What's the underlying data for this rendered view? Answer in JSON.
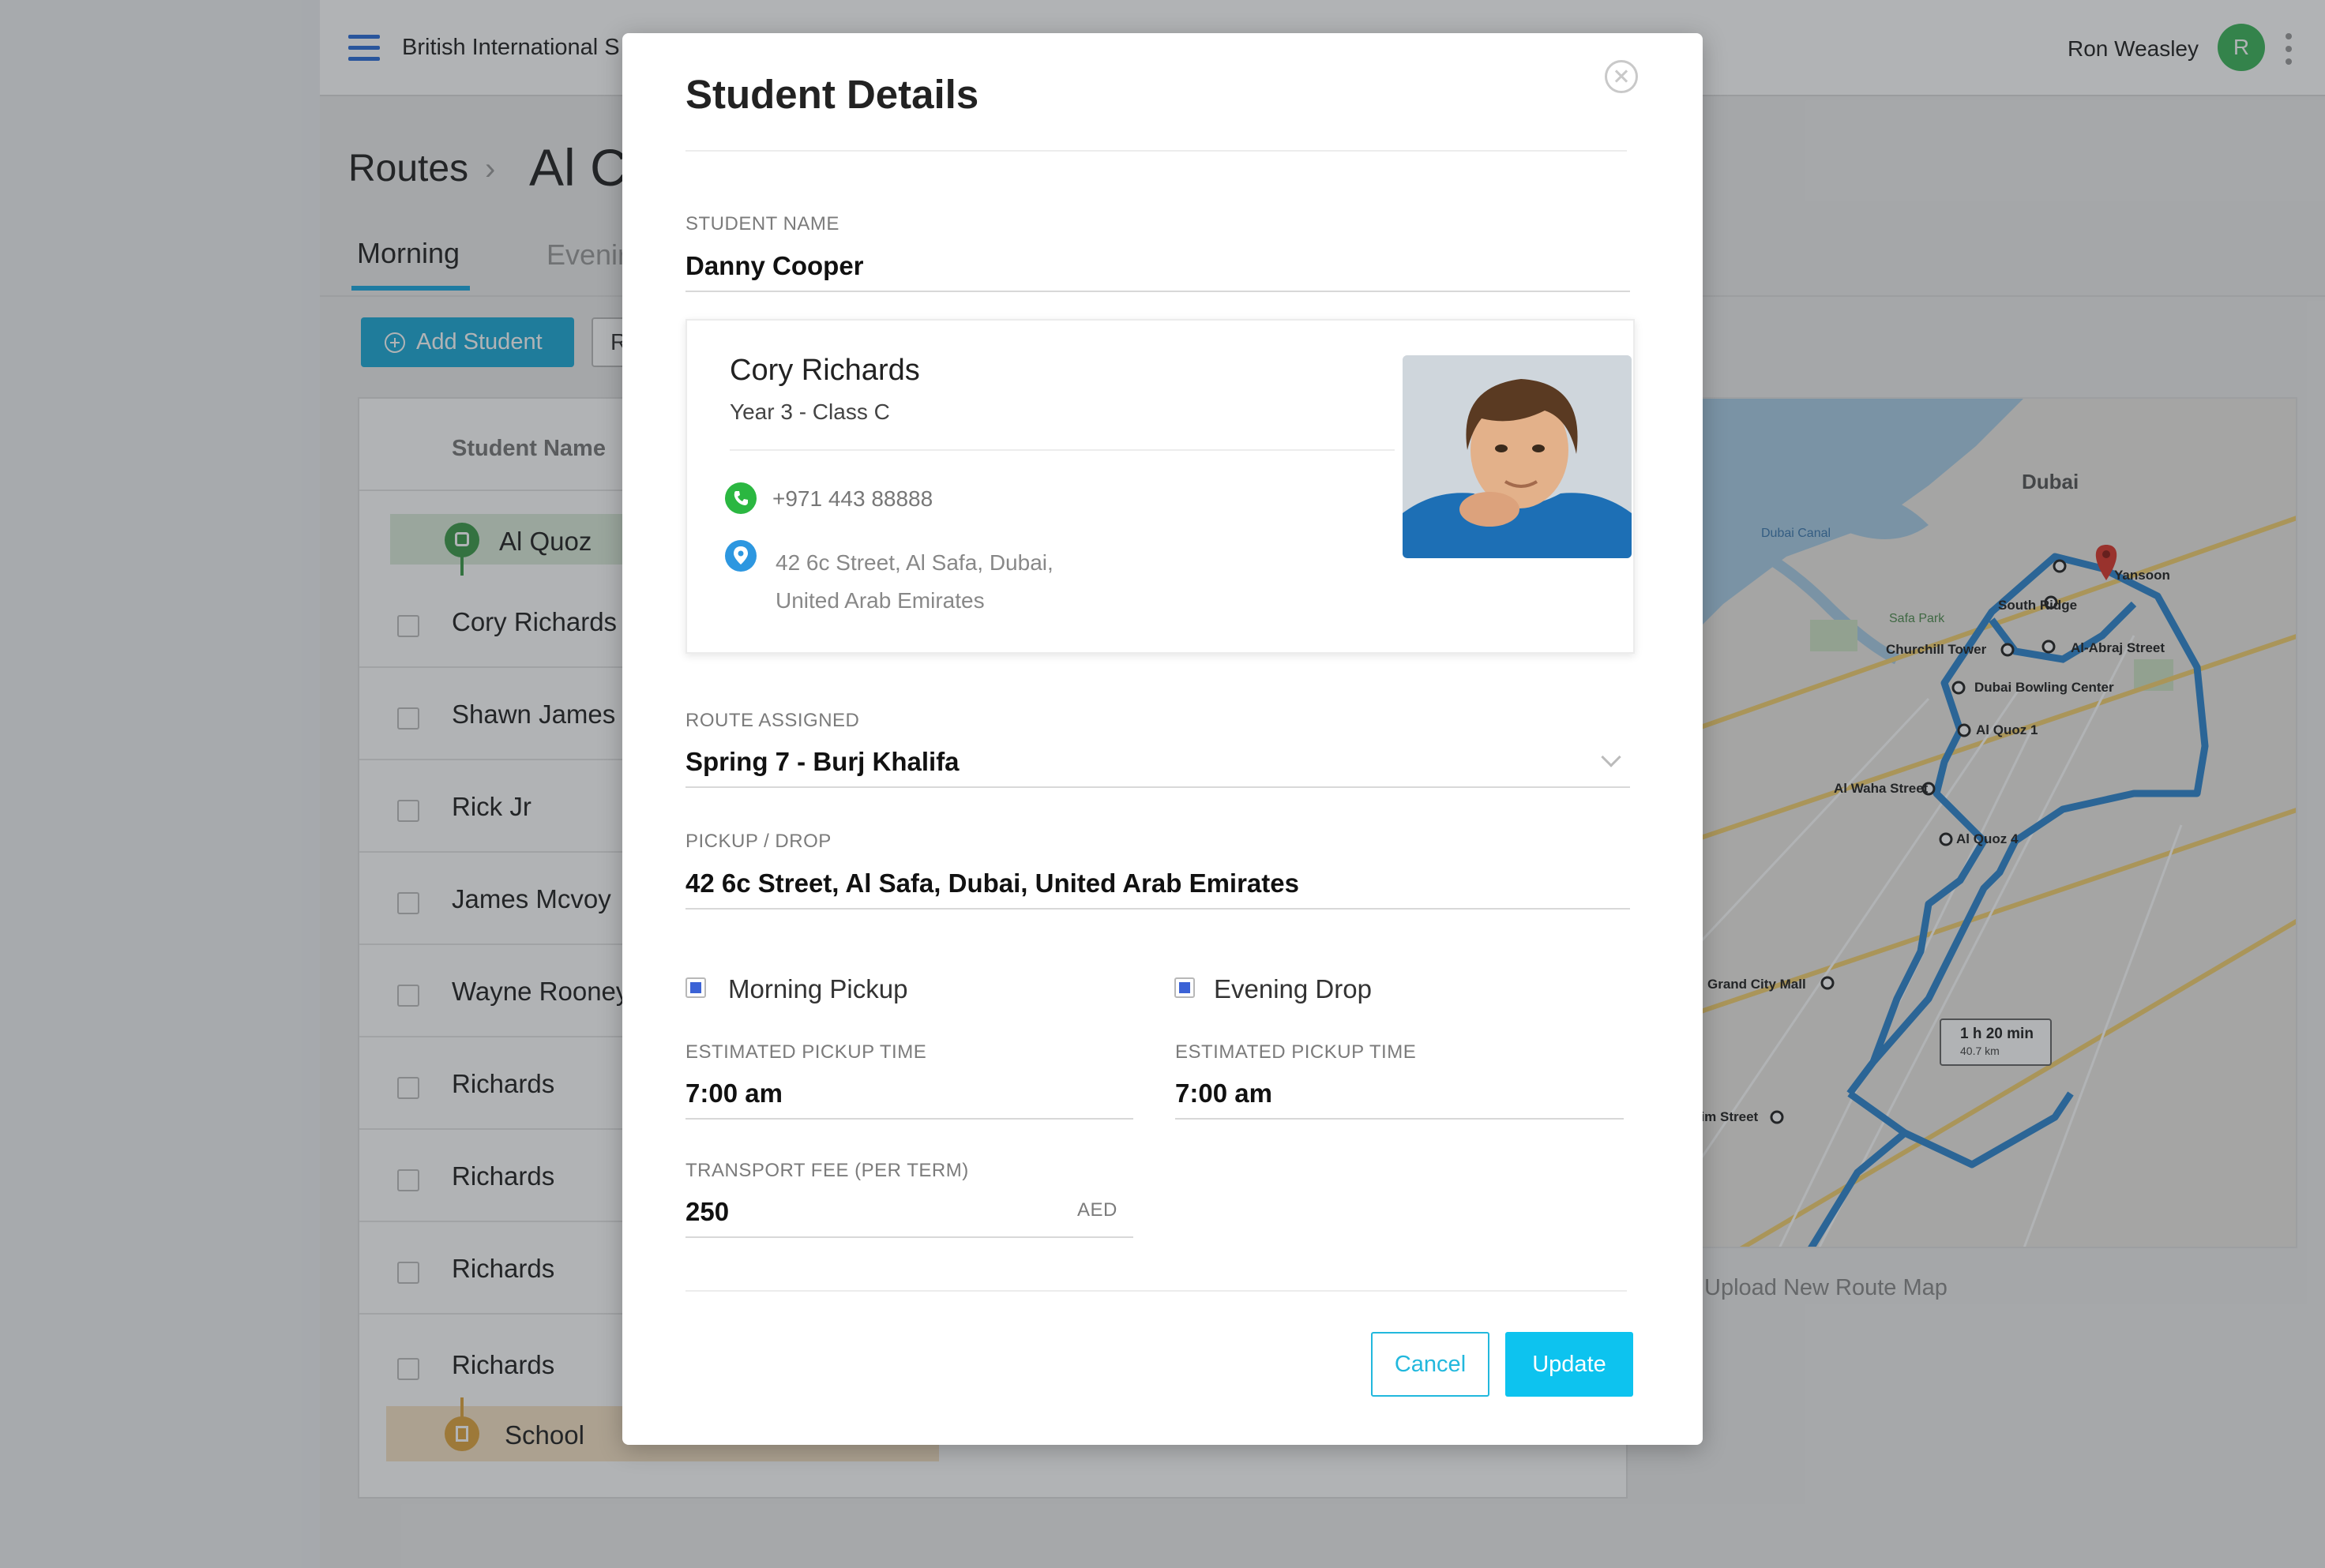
{
  "header": {
    "school_name": "British International S",
    "user_name": "Ron Weasley",
    "avatar_initial": "R"
  },
  "breadcrumb": {
    "root": "Routes",
    "separator": "›",
    "current": "Al C"
  },
  "tabs": [
    {
      "label": "Morning",
      "active": true
    },
    {
      "label": "Evenir",
      "active": false
    }
  ],
  "toolbar": {
    "add_student_label": "Add Student",
    "second_button_label": "R"
  },
  "table": {
    "header_student_name": "Student Name",
    "start_stop": "Al Quoz",
    "rows": [
      "Cory Richards",
      "Shawn James",
      "Rick Jr",
      "James Mcvoy",
      "Wayne Rooney",
      "Richards",
      "Richards",
      "Richards",
      "Richards"
    ],
    "end_stop": "School"
  },
  "map": {
    "city": "Dubai",
    "eta": "1 h 20 min",
    "distance": "40.7 km",
    "places": [
      "Yansoon",
      "South Ridge",
      "Churchill Tower",
      "Al-Abraj Street",
      "Dubai Bowling Center",
      "Al Quoz 1",
      "Al Waha Street",
      "Al Quoz 4",
      "Grand City Mall",
      "eim Street",
      "Dubai Canal",
      "Safa Park"
    ],
    "upload_label": "Upload New Route Map"
  },
  "modal": {
    "title": "Student Details",
    "student_name_label": "STUDENT NAME",
    "student_name": "Danny Cooper",
    "card": {
      "name": "Cory Richards",
      "class": "Year 3 - Class C",
      "phone": "+971 443 88888",
      "address_line1": "42 6c Street, Al Safa, Dubai,",
      "address_line2": "United Arab Emirates"
    },
    "route_label": "ROUTE ASSIGNED",
    "route_value": "Spring 7 - Burj Khalifa",
    "pickup_label": "PICKUP / DROP",
    "pickup_value": "42 6c Street, Al Safa, Dubai, United Arab Emirates",
    "morning_pickup_label": "Morning Pickup",
    "morning_pickup_checked": true,
    "evening_drop_label": "Evening Drop",
    "evening_drop_checked": true,
    "morning_time_label": "ESTIMATED PICKUP TIME",
    "morning_time": "7:00 am",
    "evening_time_label": "ESTIMATED PICKUP TIME",
    "evening_time": "7:00 am",
    "fee_label": "TRANSPORT FEE (PER TERM)",
    "fee_value": "250",
    "fee_currency": "AED",
    "cancel_label": "Cancel",
    "update_label": "Update"
  },
  "colors": {
    "accent": "#0dc3ef",
    "brand_blue": "#2b6cd8",
    "route_line": "#2e86cf",
    "checkbox_fill": "#3b62d6"
  }
}
